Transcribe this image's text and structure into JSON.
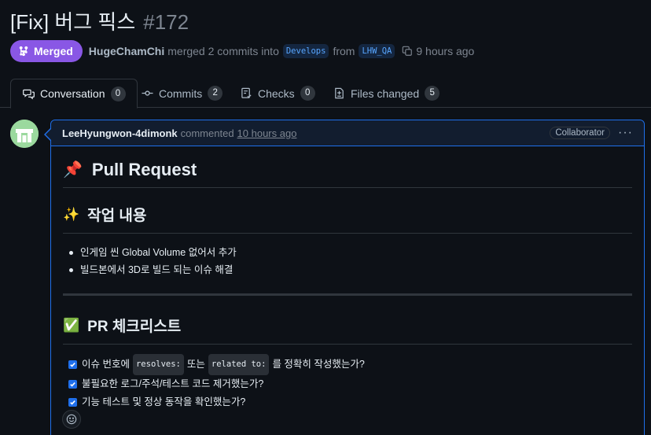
{
  "pr": {
    "title": "[Fix] 버그 픽스",
    "number": "#172",
    "state_label": "Merged",
    "author": "HugeChamChi",
    "merge_text": "merged 2 commits into",
    "base_branch": "Develops",
    "from_text": "from",
    "head_branch": "LHW_QA",
    "time": "9 hours ago"
  },
  "tabs": [
    {
      "label": "Conversation",
      "count": "0",
      "icon": "comment-discussion-icon"
    },
    {
      "label": "Commits",
      "count": "2",
      "icon": "git-commit-icon"
    },
    {
      "label": "Checks",
      "count": "0",
      "icon": "checklist-icon"
    },
    {
      "label": "Files changed",
      "count": "5",
      "icon": "file-diff-icon"
    }
  ],
  "comment": {
    "author": "LeeHyungwon-4dimonk",
    "action": "commented",
    "time": "10 hours ago",
    "role": "Collaborator",
    "h1_emoji": "📌",
    "h1": "Pull Request",
    "section1_emoji": "✨",
    "section1_title": "작업 내용",
    "bullets": [
      "인게임 씬 Global Volume 없어서 추가",
      "빌드본에서 3D로 빌드 되는 이슈 해결"
    ],
    "section2_emoji": "✅",
    "section2_title": "PR 체크리스트",
    "checklist": {
      "item1": {
        "before": "이슈 번호에",
        "code1": "resolves:",
        "mid": "또는",
        "code2": "related to:",
        "after": "를 정확히 작성했는가?"
      },
      "item2": "불필요한 로그/주석/테스트 코드 제거했는가?",
      "item3": "기능 테스트 및 정상 동작을 확인했는가?"
    }
  },
  "colors": {
    "merged": "#8957e5",
    "accent_blue": "#1f6feb",
    "background": "#0d1117"
  }
}
